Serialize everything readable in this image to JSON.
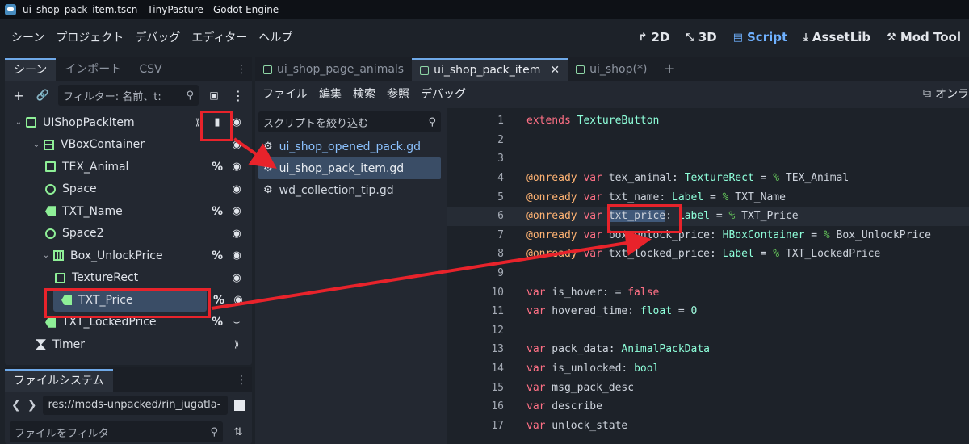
{
  "window": {
    "title": "ui_shop_pack_item.tscn - TinyPasture - Godot Engine"
  },
  "menu": [
    "シーン",
    "プロジェクト",
    "デバッグ",
    "エディター",
    "ヘルプ"
  ],
  "workspaces": [
    {
      "icon": "2d-icon",
      "label": "2D"
    },
    {
      "icon": "3d-icon",
      "label": "3D"
    },
    {
      "icon": "script-icon",
      "label": "Script"
    },
    {
      "icon": "assetlib-icon",
      "label": "AssetLib"
    },
    {
      "icon": "mod-tool-icon",
      "label": "Mod Tool"
    }
  ],
  "scene_dock": {
    "tabs": [
      "シーン",
      "インポート",
      "CSV"
    ],
    "filter_placeholder": "フィルター: 名前、t:",
    "nodes": [
      {
        "name": "UIShopPackItem",
        "depth": 0,
        "icon": "root-control-icon",
        "color": "#8eef97",
        "has_script": true,
        "signal": true
      },
      {
        "name": "VBoxContainer",
        "depth": 1,
        "icon": "vbox-icon",
        "color": "#8eef97",
        "collapse": true
      },
      {
        "name": "TEX_Animal",
        "depth": 2,
        "icon": "texture-rect-icon",
        "color": "#8eef97",
        "pct": true
      },
      {
        "name": "Space",
        "depth": 2,
        "icon": "control-icon",
        "color": "#8eef97"
      },
      {
        "name": "TXT_Name",
        "depth": 2,
        "icon": "label-icon",
        "color": "#8eef97",
        "pct": true
      },
      {
        "name": "Space2",
        "depth": 2,
        "icon": "control-icon",
        "color": "#8eef97"
      },
      {
        "name": "Box_UnlockPrice",
        "depth": 2,
        "icon": "hbox-icon",
        "color": "#8eef97",
        "pct": true,
        "collapse": true
      },
      {
        "name": "TextureRect",
        "depth": 3,
        "icon": "texture-rect-icon",
        "color": "#8eef97"
      },
      {
        "name": "TXT_Price",
        "depth": 3,
        "icon": "label-icon",
        "color": "#8eef97",
        "pct": true,
        "selected": true
      },
      {
        "name": "TXT_LockedPrice",
        "depth": 2,
        "icon": "label-icon",
        "color": "#8eef97",
        "pct": true,
        "hidden": true
      },
      {
        "name": "Timer",
        "depth": 1,
        "icon": "timer-icon",
        "color": "#e0e4ea",
        "signal": true
      }
    ]
  },
  "filesystem_dock": {
    "tab": "ファイルシステム",
    "path": "res://mods-unpacked/rin_jugatla-",
    "filter_placeholder": "ファイルをフィルタ"
  },
  "editor": {
    "tabs": [
      {
        "label": "ui_shop_page_animals",
        "active": false
      },
      {
        "label": "ui_shop_pack_item",
        "active": true
      },
      {
        "label": "ui_shop(*)",
        "active": false
      }
    ],
    "menu": [
      "ファイル",
      "編集",
      "検索",
      "参照",
      "デバッグ"
    ],
    "online_label": "オンラ",
    "script_filter_placeholder": "スクリプトを絞り込む",
    "scripts": [
      {
        "name": "ui_shop_opened_pack.gd",
        "state": "blue"
      },
      {
        "name": "ui_shop_pack_item.gd",
        "state": "active"
      },
      {
        "name": "wd_collection_tip.gd",
        "state": "normal"
      }
    ],
    "current_line": 6,
    "lines": [
      {
        "n": "1",
        "text": "extends TextureButton"
      },
      {
        "n": "2",
        "text": ""
      },
      {
        "n": "3",
        "text": ""
      },
      {
        "n": "4",
        "text": "@onready var tex_animal: TextureRect = % TEX_Animal"
      },
      {
        "n": "5",
        "text": "@onready var txt_name: Label = % TXT_Name"
      },
      {
        "n": "6",
        "text": "@onready var txt_price: Label = % TXT_Price"
      },
      {
        "n": "7",
        "text": "@onready var box_unlock_price: HBoxContainer = % Box_UnlockPrice"
      },
      {
        "n": "8",
        "text": "@onready var txt_locked_price: Label = % TXT_LockedPrice"
      },
      {
        "n": "9",
        "text": ""
      },
      {
        "n": "10",
        "text": "var is_hover: = false"
      },
      {
        "n": "11",
        "text": "var hovered_time: float = 0"
      },
      {
        "n": "12",
        "text": ""
      },
      {
        "n": "13",
        "text": "var pack_data: AnimalPackData"
      },
      {
        "n": "14",
        "text": "var is_unlocked: bool"
      },
      {
        "n": "15",
        "text": "var msg_pack_desc"
      },
      {
        "n": "16",
        "text": "var describe"
      },
      {
        "n": "17",
        "text": "var unlock_state"
      }
    ]
  },
  "colors": {
    "annotation_red": "#e8232b",
    "accent_blue": "#6fb1ff",
    "node_green": "#8eef97"
  }
}
